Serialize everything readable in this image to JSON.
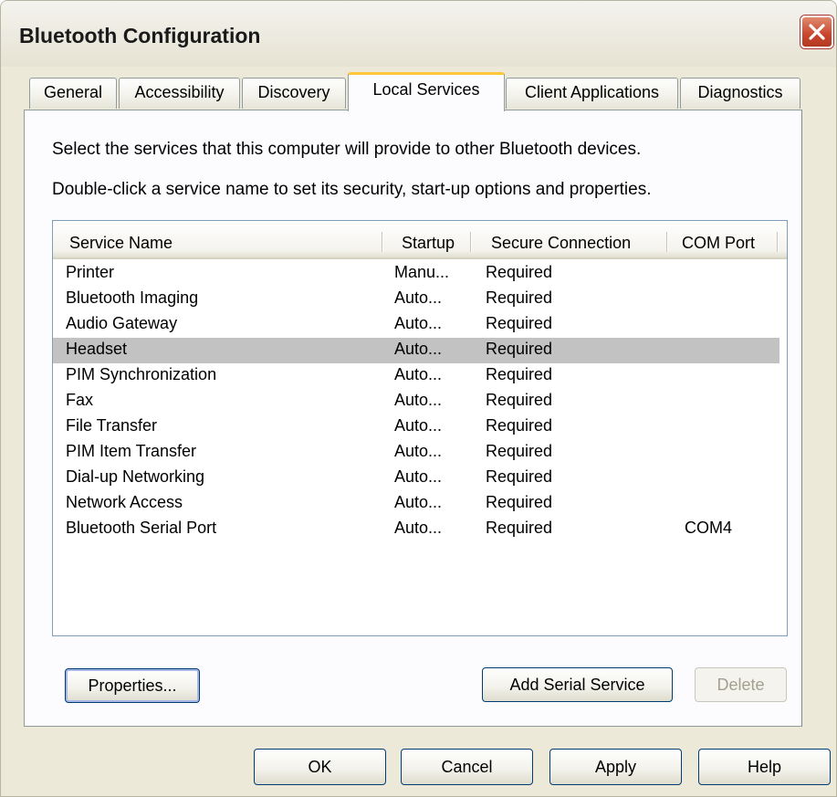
{
  "window": {
    "title": "Bluetooth Configuration"
  },
  "tabs": [
    {
      "label": "General"
    },
    {
      "label": "Accessibility"
    },
    {
      "label": "Discovery"
    },
    {
      "label": "Local Services",
      "active": true
    },
    {
      "label": "Client Applications"
    },
    {
      "label": "Diagnostics"
    }
  ],
  "instructions": {
    "line1": "Select the services that this computer will provide to other Bluetooth devices.",
    "line2": "Double-click a service name to set its security, start-up options and properties."
  },
  "services_table": {
    "columns": [
      "Service Name",
      "Startup",
      "Secure Connection",
      "COM Port"
    ],
    "rows": [
      {
        "name": "Printer",
        "startup": "Manu...",
        "secure": "Required",
        "com": ""
      },
      {
        "name": "Bluetooth Imaging",
        "startup": "Auto...",
        "secure": "Required",
        "com": ""
      },
      {
        "name": "Audio Gateway",
        "startup": "Auto...",
        "secure": "Required",
        "com": ""
      },
      {
        "name": "Headset",
        "startup": "Auto...",
        "secure": "Required",
        "com": "",
        "selected": true
      },
      {
        "name": "PIM Synchronization",
        "startup": "Auto...",
        "secure": "Required",
        "com": ""
      },
      {
        "name": "Fax",
        "startup": "Auto...",
        "secure": "Required",
        "com": ""
      },
      {
        "name": "File Transfer",
        "startup": "Auto...",
        "secure": "Required",
        "com": ""
      },
      {
        "name": "PIM Item Transfer",
        "startup": "Auto...",
        "secure": "Required",
        "com": ""
      },
      {
        "name": "Dial-up Networking",
        "startup": "Auto...",
        "secure": "Required",
        "com": ""
      },
      {
        "name": "Network Access",
        "startup": "Auto...",
        "secure": "Required",
        "com": ""
      },
      {
        "name": "Bluetooth Serial Port",
        "startup": "Auto...",
        "secure": "Required",
        "com": "COM4"
      }
    ]
  },
  "panel_buttons": {
    "properties": "Properties...",
    "add_serial": "Add Serial Service",
    "delete": "Delete"
  },
  "dialog_buttons": {
    "ok": "OK",
    "cancel": "Cancel",
    "apply": "Apply",
    "help": "Help"
  },
  "icons": {
    "close": "close-icon"
  },
  "colors": {
    "selection": "#c2c2c2",
    "active_tab_accent": "#ffc83c",
    "close_button": "#c8452c"
  }
}
